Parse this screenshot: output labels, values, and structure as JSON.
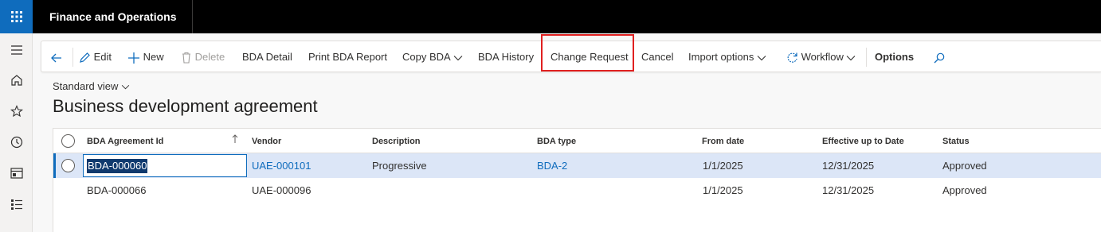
{
  "app": {
    "title": "Finance and Operations"
  },
  "actions": {
    "edit": "Edit",
    "new": "New",
    "delete": "Delete",
    "bda_detail": "BDA Detail",
    "print_bda_report": "Print BDA Report",
    "copy_bda": "Copy BDA",
    "bda_history": "BDA History",
    "change_request": "Change Request",
    "cancel": "Cancel",
    "import_options": "Import options",
    "workflow": "Workflow",
    "options": "Options"
  },
  "view": {
    "selector": "Standard view"
  },
  "page": {
    "title": "Business development agreement"
  },
  "grid": {
    "columns": [
      "BDA Agreement Id",
      "Vendor",
      "Description",
      "BDA type",
      "From date",
      "Effective up to Date",
      "Status"
    ],
    "rows": [
      {
        "id": "BDA-000060",
        "vendor": "UAE-000101",
        "description": "Progressive",
        "type": "BDA-2",
        "from": "1/1/2025",
        "to": "12/31/2025",
        "status": "Approved"
      },
      {
        "id": "BDA-000066",
        "vendor": "UAE-000096",
        "description": "",
        "type": "",
        "from": "1/1/2025",
        "to": "12/31/2025",
        "status": "Approved"
      }
    ]
  },
  "colors": {
    "accent": "#0f6cbd",
    "selected_row": "#dce6f7",
    "highlight_border": "#e02020"
  }
}
